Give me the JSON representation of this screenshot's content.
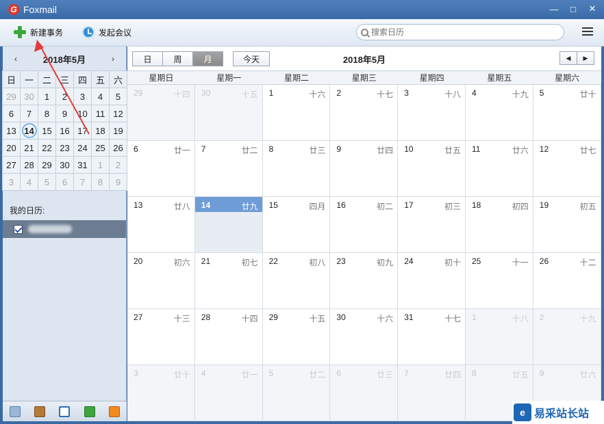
{
  "app": {
    "title": "Foxmail",
    "logo_letter": "G"
  },
  "window_controls": {
    "minimize": "—",
    "maximize": "□",
    "close": "✕"
  },
  "toolbar": {
    "new_event": "新建事务",
    "start_meeting": "发起会议",
    "search_placeholder": "搜索日历"
  },
  "mini_calendar": {
    "title": "2018年5月",
    "prev": "‹",
    "next": "›",
    "weekdays": [
      "日",
      "一",
      "二",
      "三",
      "四",
      "五",
      "六"
    ],
    "weeks": [
      [
        "29",
        "30",
        "1",
        "2",
        "3",
        "4",
        "5"
      ],
      [
        "6",
        "7",
        "8",
        "9",
        "10",
        "11",
        "12"
      ],
      [
        "13",
        "14",
        "15",
        "16",
        "17",
        "18",
        "19"
      ],
      [
        "20",
        "21",
        "22",
        "23",
        "24",
        "25",
        "26"
      ],
      [
        "27",
        "28",
        "29",
        "30",
        "31",
        "1",
        "2"
      ],
      [
        "3",
        "4",
        "5",
        "6",
        "7",
        "8",
        "9"
      ]
    ]
  },
  "sidebar": {
    "my_calendars_label": "我的日历:"
  },
  "view_bar": {
    "views": [
      "日",
      "周",
      "月"
    ],
    "active_view": "月",
    "today_button": "今天",
    "month_title": "2018年5月",
    "prev": "◀",
    "next": "▶"
  },
  "month_grid": {
    "weekdays": [
      "星期日",
      "星期一",
      "星期二",
      "星期三",
      "星期四",
      "星期五",
      "星期六"
    ],
    "weeks": [
      [
        [
          "29",
          "十四"
        ],
        [
          "30",
          "十五"
        ],
        [
          "1",
          "十六"
        ],
        [
          "2",
          "十七"
        ],
        [
          "3",
          "十八"
        ],
        [
          "4",
          "十九"
        ],
        [
          "5",
          "廿十"
        ]
      ],
      [
        [
          "6",
          "廿一"
        ],
        [
          "7",
          "廿二"
        ],
        [
          "8",
          "廿三"
        ],
        [
          "9",
          "廿四"
        ],
        [
          "10",
          "廿五"
        ],
        [
          "11",
          "廿六"
        ],
        [
          "12",
          "廿七"
        ]
      ],
      [
        [
          "13",
          "廿八"
        ],
        [
          "14",
          "廿九"
        ],
        [
          "15",
          "四月"
        ],
        [
          "16",
          "初二"
        ],
        [
          "17",
          "初三"
        ],
        [
          "18",
          "初四"
        ],
        [
          "19",
          "初五"
        ]
      ],
      [
        [
          "20",
          "初六"
        ],
        [
          "21",
          "初七"
        ],
        [
          "22",
          "初八"
        ],
        [
          "23",
          "初九"
        ],
        [
          "24",
          "初十"
        ],
        [
          "25",
          "十一"
        ],
        [
          "26",
          "十二"
        ]
      ],
      [
        [
          "27",
          "十三"
        ],
        [
          "28",
          "十四"
        ],
        [
          "29",
          "十五"
        ],
        [
          "30",
          "十六"
        ],
        [
          "31",
          "十七"
        ],
        [
          "1",
          "十八"
        ],
        [
          "2",
          "十九"
        ]
      ],
      [
        [
          "3",
          "廿十"
        ],
        [
          "4",
          "廿一"
        ],
        [
          "5",
          "廿二"
        ],
        [
          "6",
          "廿三"
        ],
        [
          "7",
          "廿四"
        ],
        [
          "8",
          "廿五"
        ],
        [
          "9",
          "廿六"
        ]
      ]
    ]
  },
  "watermark": {
    "logo": "e",
    "text": "易采站长站"
  },
  "colors": {
    "accent": "#6e9cd6",
    "titlebar": "#3a6aa6",
    "annotation_arrow": "#e23b3b"
  }
}
